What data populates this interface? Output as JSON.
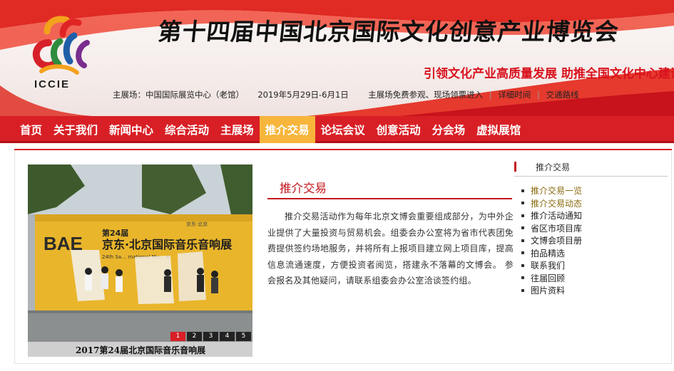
{
  "header": {
    "logo_text": "ICCIE",
    "main_title": "第十四届中国北京国际文化创意产业博览会",
    "slogan": "引领文化产业高质量发展  助推全国文化中心建设",
    "venue": "主展场：中国国际展览中心（老馆）",
    "dates": "2019年5月29日-6月1日",
    "admission": "主展场免费参观、现场领票进入",
    "details_link": "详细时间",
    "traffic_link": "交通路线",
    "separator": "|"
  },
  "nav": {
    "items": [
      "首页",
      "关于我们",
      "新闻中心",
      "综合活动",
      "主展场",
      "推介交易",
      "论坛会议",
      "创意活动",
      "分会场",
      "虚拟展馆"
    ],
    "active_index": 5
  },
  "slideshow": {
    "caption": "2017第24届北京国际音乐音响展",
    "pages": [
      "1",
      "2",
      "3",
      "4",
      "5"
    ],
    "active_page": 0,
    "stage_text": {
      "logo": "BAE",
      "edition": "第24届",
      "title": "京东·北京国际音乐音响展",
      "subtitle": "24th Sa… rnational Mu… w",
      "sponsor": "京东·北京"
    }
  },
  "article": {
    "title": "推介交易",
    "body": "推介交易活动作为每年北京文博会重要组成部分，为中外企业提供了大量投资与贸易机会。组委会办公室将为省市代表团免费提供签约场地服务，并将所有上报项目建立网上项目库，提高信息流通速度，方便投资者阅览，搭建永不落幕的文博会。 参会报名及其他疑问，请联系组委会办公室洽谈签约组。"
  },
  "sidebar": {
    "heading": "推介交易",
    "items": [
      "推介交易一览",
      "推介交易动态",
      "推介活动通知",
      "省区市项目库",
      "文博会项目册",
      "拍品精选",
      "联系我们",
      "往届回顾",
      "图片资料"
    ],
    "highlighted": [
      0,
      1
    ]
  },
  "colors": {
    "brand_red": "#d81f26",
    "nav_active": "#f7b53b",
    "title_red": "#c4161c",
    "slogan_red": "#d9121e"
  }
}
